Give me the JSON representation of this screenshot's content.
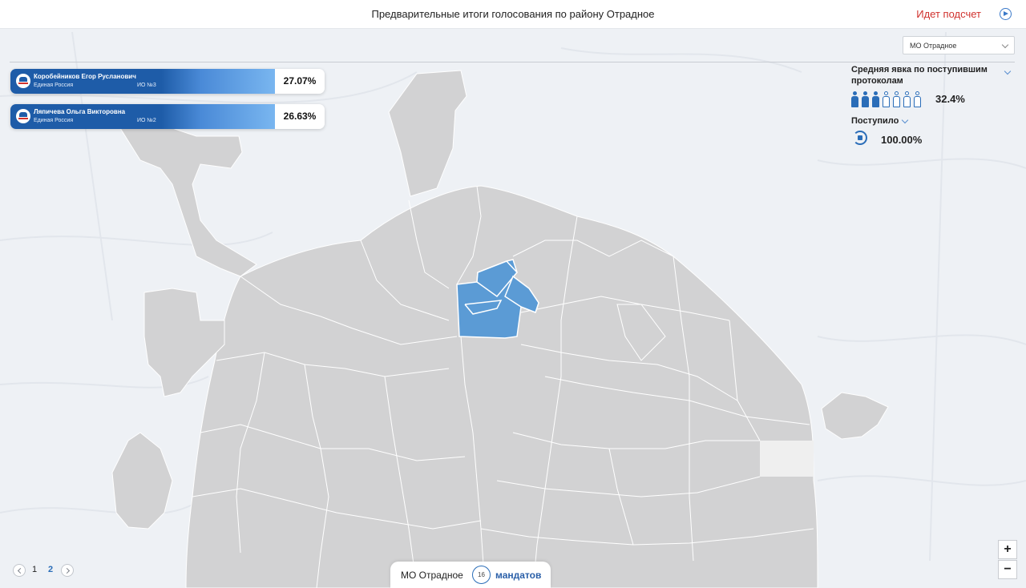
{
  "header": {
    "title": "Предварительные итоги голосования по району Отрадное",
    "status": "Идет подсчет"
  },
  "district_select": {
    "value": "МО Отрадное"
  },
  "candidates": [
    {
      "name": "Коробейников Егор Русланович",
      "party": "Единая Россия",
      "district": "ИО №3",
      "percent": "27.07%"
    },
    {
      "name": "Ляпичева Ольга Викторовна",
      "party": "Единая Россия",
      "district": "ИО №2",
      "percent": "26.63%"
    }
  ],
  "stats": {
    "turnout_label": "Средняя явка по поступившим протоколам",
    "turnout_value": "32.4%",
    "turnout_fraction": 0.324,
    "received_label": "Поступило",
    "received_value": "100.00%"
  },
  "pager": {
    "pages": [
      "1",
      "2"
    ],
    "current": "2"
  },
  "bottom": {
    "district": "МО Отрадное",
    "count": "16",
    "unit": "мандатов"
  },
  "zoom": {
    "in": "+",
    "out": "−"
  },
  "colors": {
    "accent": "#2a6db8",
    "status": "#d0312d",
    "highlight": "#5b9bd5",
    "region": "#d2d2d3"
  }
}
